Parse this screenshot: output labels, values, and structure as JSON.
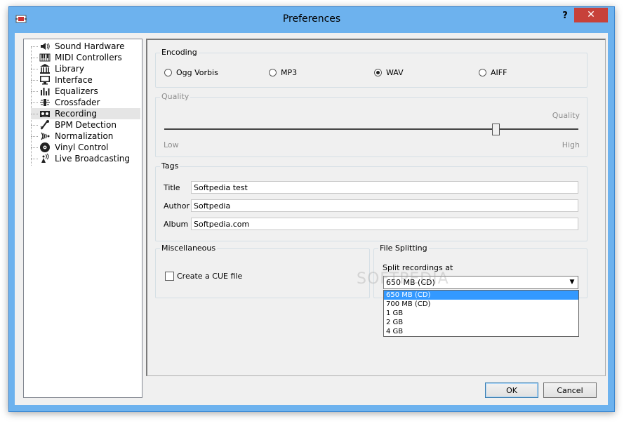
{
  "window": {
    "title": "Preferences",
    "help_glyph": "?",
    "close_glyph": "✕"
  },
  "tree": {
    "items": [
      {
        "label": "Sound Hardware",
        "icon": "speaker-icon"
      },
      {
        "label": "MIDI Controllers",
        "icon": "keyboard-icon"
      },
      {
        "label": "Library",
        "icon": "library-icon"
      },
      {
        "label": "Interface",
        "icon": "monitor-icon"
      },
      {
        "label": "Equalizers",
        "icon": "equalizer-icon"
      },
      {
        "label": "Crossfader",
        "icon": "crossfader-icon"
      },
      {
        "label": "Recording",
        "icon": "tape-icon"
      },
      {
        "label": "BPM Detection",
        "icon": "metronome-icon"
      },
      {
        "label": "Normalization",
        "icon": "normalization-icon"
      },
      {
        "label": "Vinyl Control",
        "icon": "vinyl-icon"
      },
      {
        "label": "Live Broadcasting",
        "icon": "broadcast-icon"
      }
    ],
    "selected": "Recording"
  },
  "encoding": {
    "legend": "Encoding",
    "options": [
      {
        "label": "Ogg Vorbis",
        "checked": false
      },
      {
        "label": "MP3",
        "checked": false
      },
      {
        "label": "WAV",
        "checked": true
      },
      {
        "label": "AIFF",
        "checked": false
      }
    ]
  },
  "quality": {
    "legend": "Quality",
    "caption": "Quality",
    "low_label": "Low",
    "high_label": "High",
    "level": 0.8
  },
  "tags": {
    "legend": "Tags",
    "title_label": "Title",
    "title_value": "Softpedia test",
    "author_label": "Author",
    "author_value": "Softpedia",
    "album_label": "Album",
    "album_value": "Softpedia.com"
  },
  "misc": {
    "legend": "Miscellaneous",
    "cue_label": "Create a CUE file",
    "cue_checked": false
  },
  "file_splitting": {
    "legend": "File Splitting",
    "split_label": "Split recordings at",
    "selected": "650 MB (CD)",
    "options": [
      "650 MB (CD)",
      "700 MB (CD)",
      "1 GB",
      "2 GB",
      "4 GB"
    ]
  },
  "buttons": {
    "ok": "OK",
    "cancel": "Cancel"
  },
  "watermark": "SOFTPEDIA"
}
